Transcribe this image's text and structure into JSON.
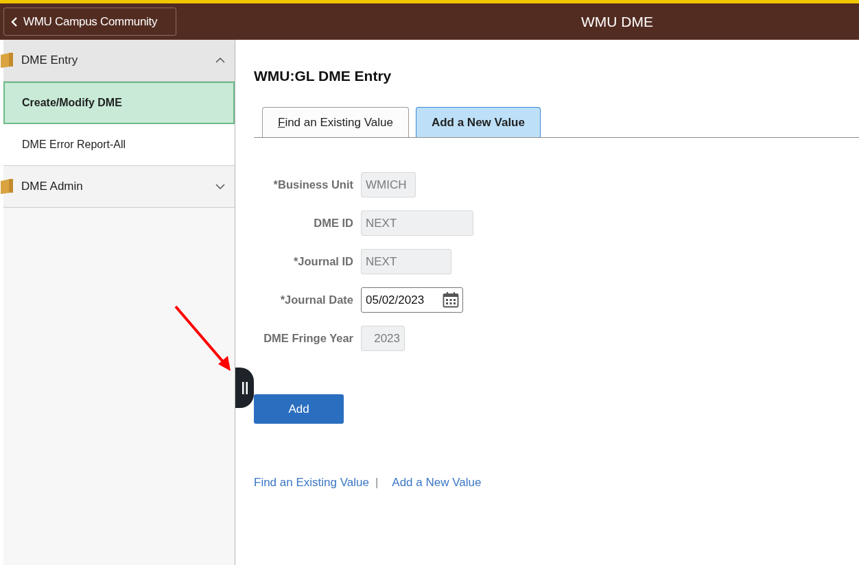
{
  "header": {
    "back_button": "WMU Campus Community",
    "title": "WMU DME"
  },
  "sidebar": {
    "groups": [
      {
        "label": "DME Entry",
        "expanded": true,
        "items": [
          {
            "label": "Create/Modify DME",
            "selected": true
          },
          {
            "label": "DME Error Report-All",
            "selected": false
          }
        ]
      },
      {
        "label": "DME Admin",
        "expanded": false
      }
    ]
  },
  "page_title": "WMU:GL DME Entry",
  "tabs": [
    {
      "label": "Find an Existing Value",
      "selected": false,
      "shortcut_underlined": true
    },
    {
      "label": "Add a New Value",
      "selected": true,
      "shortcut_underlined": false
    }
  ],
  "fields": [
    {
      "label": "*Business Unit",
      "value": "WMICH",
      "kind": "text",
      "disabled": true
    },
    {
      "label": "DME ID",
      "value": "NEXT",
      "kind": "text",
      "disabled": true
    },
    {
      "label": "*Journal ID",
      "value": "NEXT",
      "kind": "text",
      "disabled": true
    },
    {
      "label": "*Journal Date",
      "value": "05/02/2023",
      "kind": "date",
      "disabled": false
    },
    {
      "label": "DME Fringe Year",
      "value": "2023",
      "kind": "number",
      "disabled": true
    }
  ],
  "add_button": "Add",
  "footer_links": [
    "Find an Existing Value",
    "Add a New Value"
  ],
  "footer_separator": "|"
}
